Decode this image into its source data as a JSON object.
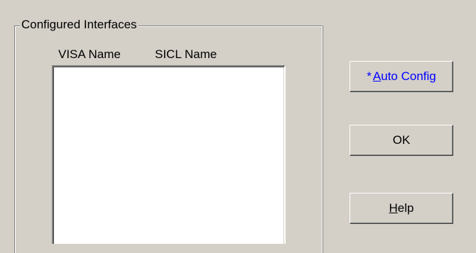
{
  "group": {
    "title": "Configured Interfaces",
    "columns": [
      "VISA Name",
      "SICL Name"
    ],
    "items": []
  },
  "buttons": {
    "auto_config": {
      "prefix": "*",
      "mnemonic": "A",
      "rest": "uto Config"
    },
    "ok": {
      "label": "OK"
    },
    "help": {
      "mnemonic": "H",
      "rest": "elp"
    }
  },
  "colors": {
    "face": "#d4d0c8",
    "link": "#0000ff"
  }
}
